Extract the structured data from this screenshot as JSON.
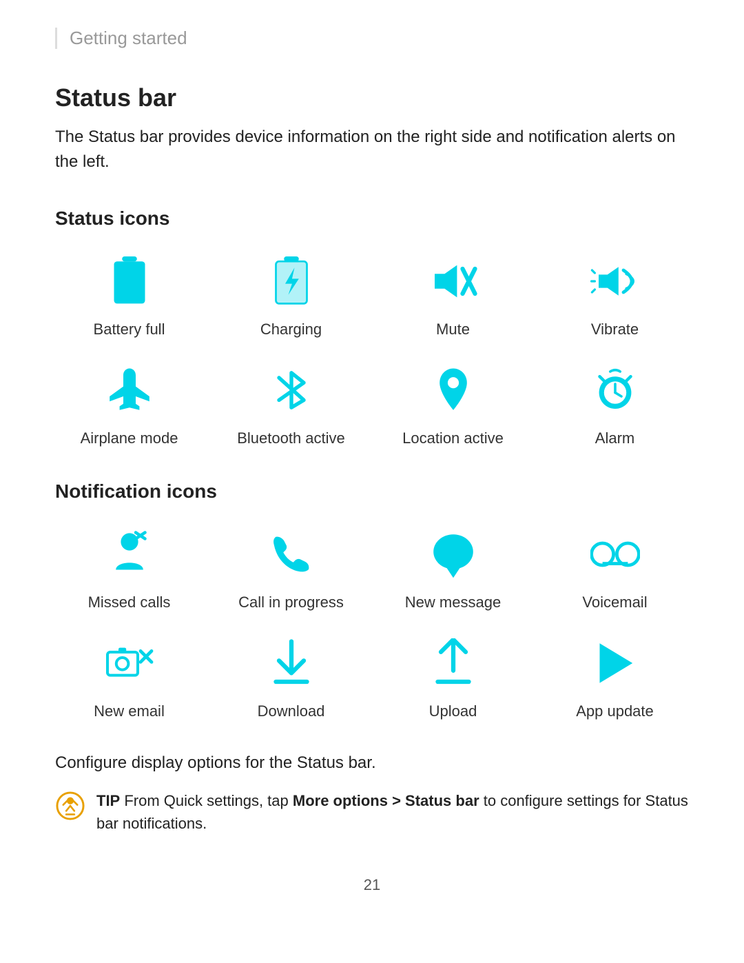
{
  "breadcrumb": "Getting started",
  "section": {
    "title": "Status bar",
    "description": "The Status bar provides device information on the right side and notification alerts on the left."
  },
  "status_icons_title": "Status icons",
  "status_icons": [
    {
      "label": "Battery full",
      "icon": "battery-full"
    },
    {
      "label": "Charging",
      "icon": "charging"
    },
    {
      "label": "Mute",
      "icon": "mute"
    },
    {
      "label": "Vibrate",
      "icon": "vibrate"
    },
    {
      "label": "Airplane mode",
      "icon": "airplane"
    },
    {
      "label": "Bluetooth active",
      "icon": "bluetooth"
    },
    {
      "label": "Location active",
      "icon": "location"
    },
    {
      "label": "Alarm",
      "icon": "alarm"
    }
  ],
  "notification_icons_title": "Notification icons",
  "notification_icons": [
    {
      "label": "Missed calls",
      "icon": "missed-calls"
    },
    {
      "label": "Call in progress",
      "icon": "call-in-progress"
    },
    {
      "label": "New message",
      "icon": "new-message"
    },
    {
      "label": "Voicemail",
      "icon": "voicemail"
    },
    {
      "label": "New email",
      "icon": "new-email"
    },
    {
      "label": "Download",
      "icon": "download"
    },
    {
      "label": "Upload",
      "icon": "upload"
    },
    {
      "label": "App update",
      "icon": "app-update"
    }
  ],
  "configure_text": "Configure display options for the Status bar.",
  "tip": {
    "label": "TIP",
    "text": " From Quick settings, tap ",
    "bold1": "More options > Status bar",
    "text2": " to configure settings for Status bar notifications."
  },
  "page_number": "21"
}
